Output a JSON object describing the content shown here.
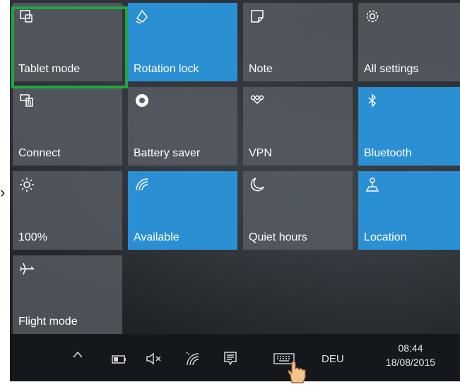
{
  "tiles": [
    {
      "label": "Tablet mode",
      "icon": "tablet-mode-icon",
      "active": false
    },
    {
      "label": "Rotation lock",
      "icon": "rotation-lock-icon",
      "active": true
    },
    {
      "label": "Note",
      "icon": "note-icon",
      "active": false
    },
    {
      "label": "All settings",
      "icon": "gear-icon",
      "active": false
    },
    {
      "label": "Connect",
      "icon": "connect-icon",
      "active": false
    },
    {
      "label": "Battery saver",
      "icon": "battery-saver-icon",
      "active": false
    },
    {
      "label": "VPN",
      "icon": "vpn-icon",
      "active": false
    },
    {
      "label": "Bluetooth",
      "icon": "bluetooth-icon",
      "active": true
    },
    {
      "label": "100%",
      "icon": "brightness-icon",
      "active": false
    },
    {
      "label": "Available",
      "icon": "wifi-icon",
      "active": true
    },
    {
      "label": "Quiet hours",
      "icon": "moon-icon",
      "active": false
    },
    {
      "label": "Location",
      "icon": "location-icon",
      "active": true
    },
    {
      "label": "Flight mode",
      "icon": "airplane-icon",
      "active": false
    }
  ],
  "taskbar": {
    "language": "DEU",
    "time": "08:44",
    "date": "18/08/2015"
  },
  "colors": {
    "accent": "#2b8fd4",
    "tile_inactive": "#5a5f66",
    "highlight": "#23a543",
    "taskbar": "#14181c"
  }
}
